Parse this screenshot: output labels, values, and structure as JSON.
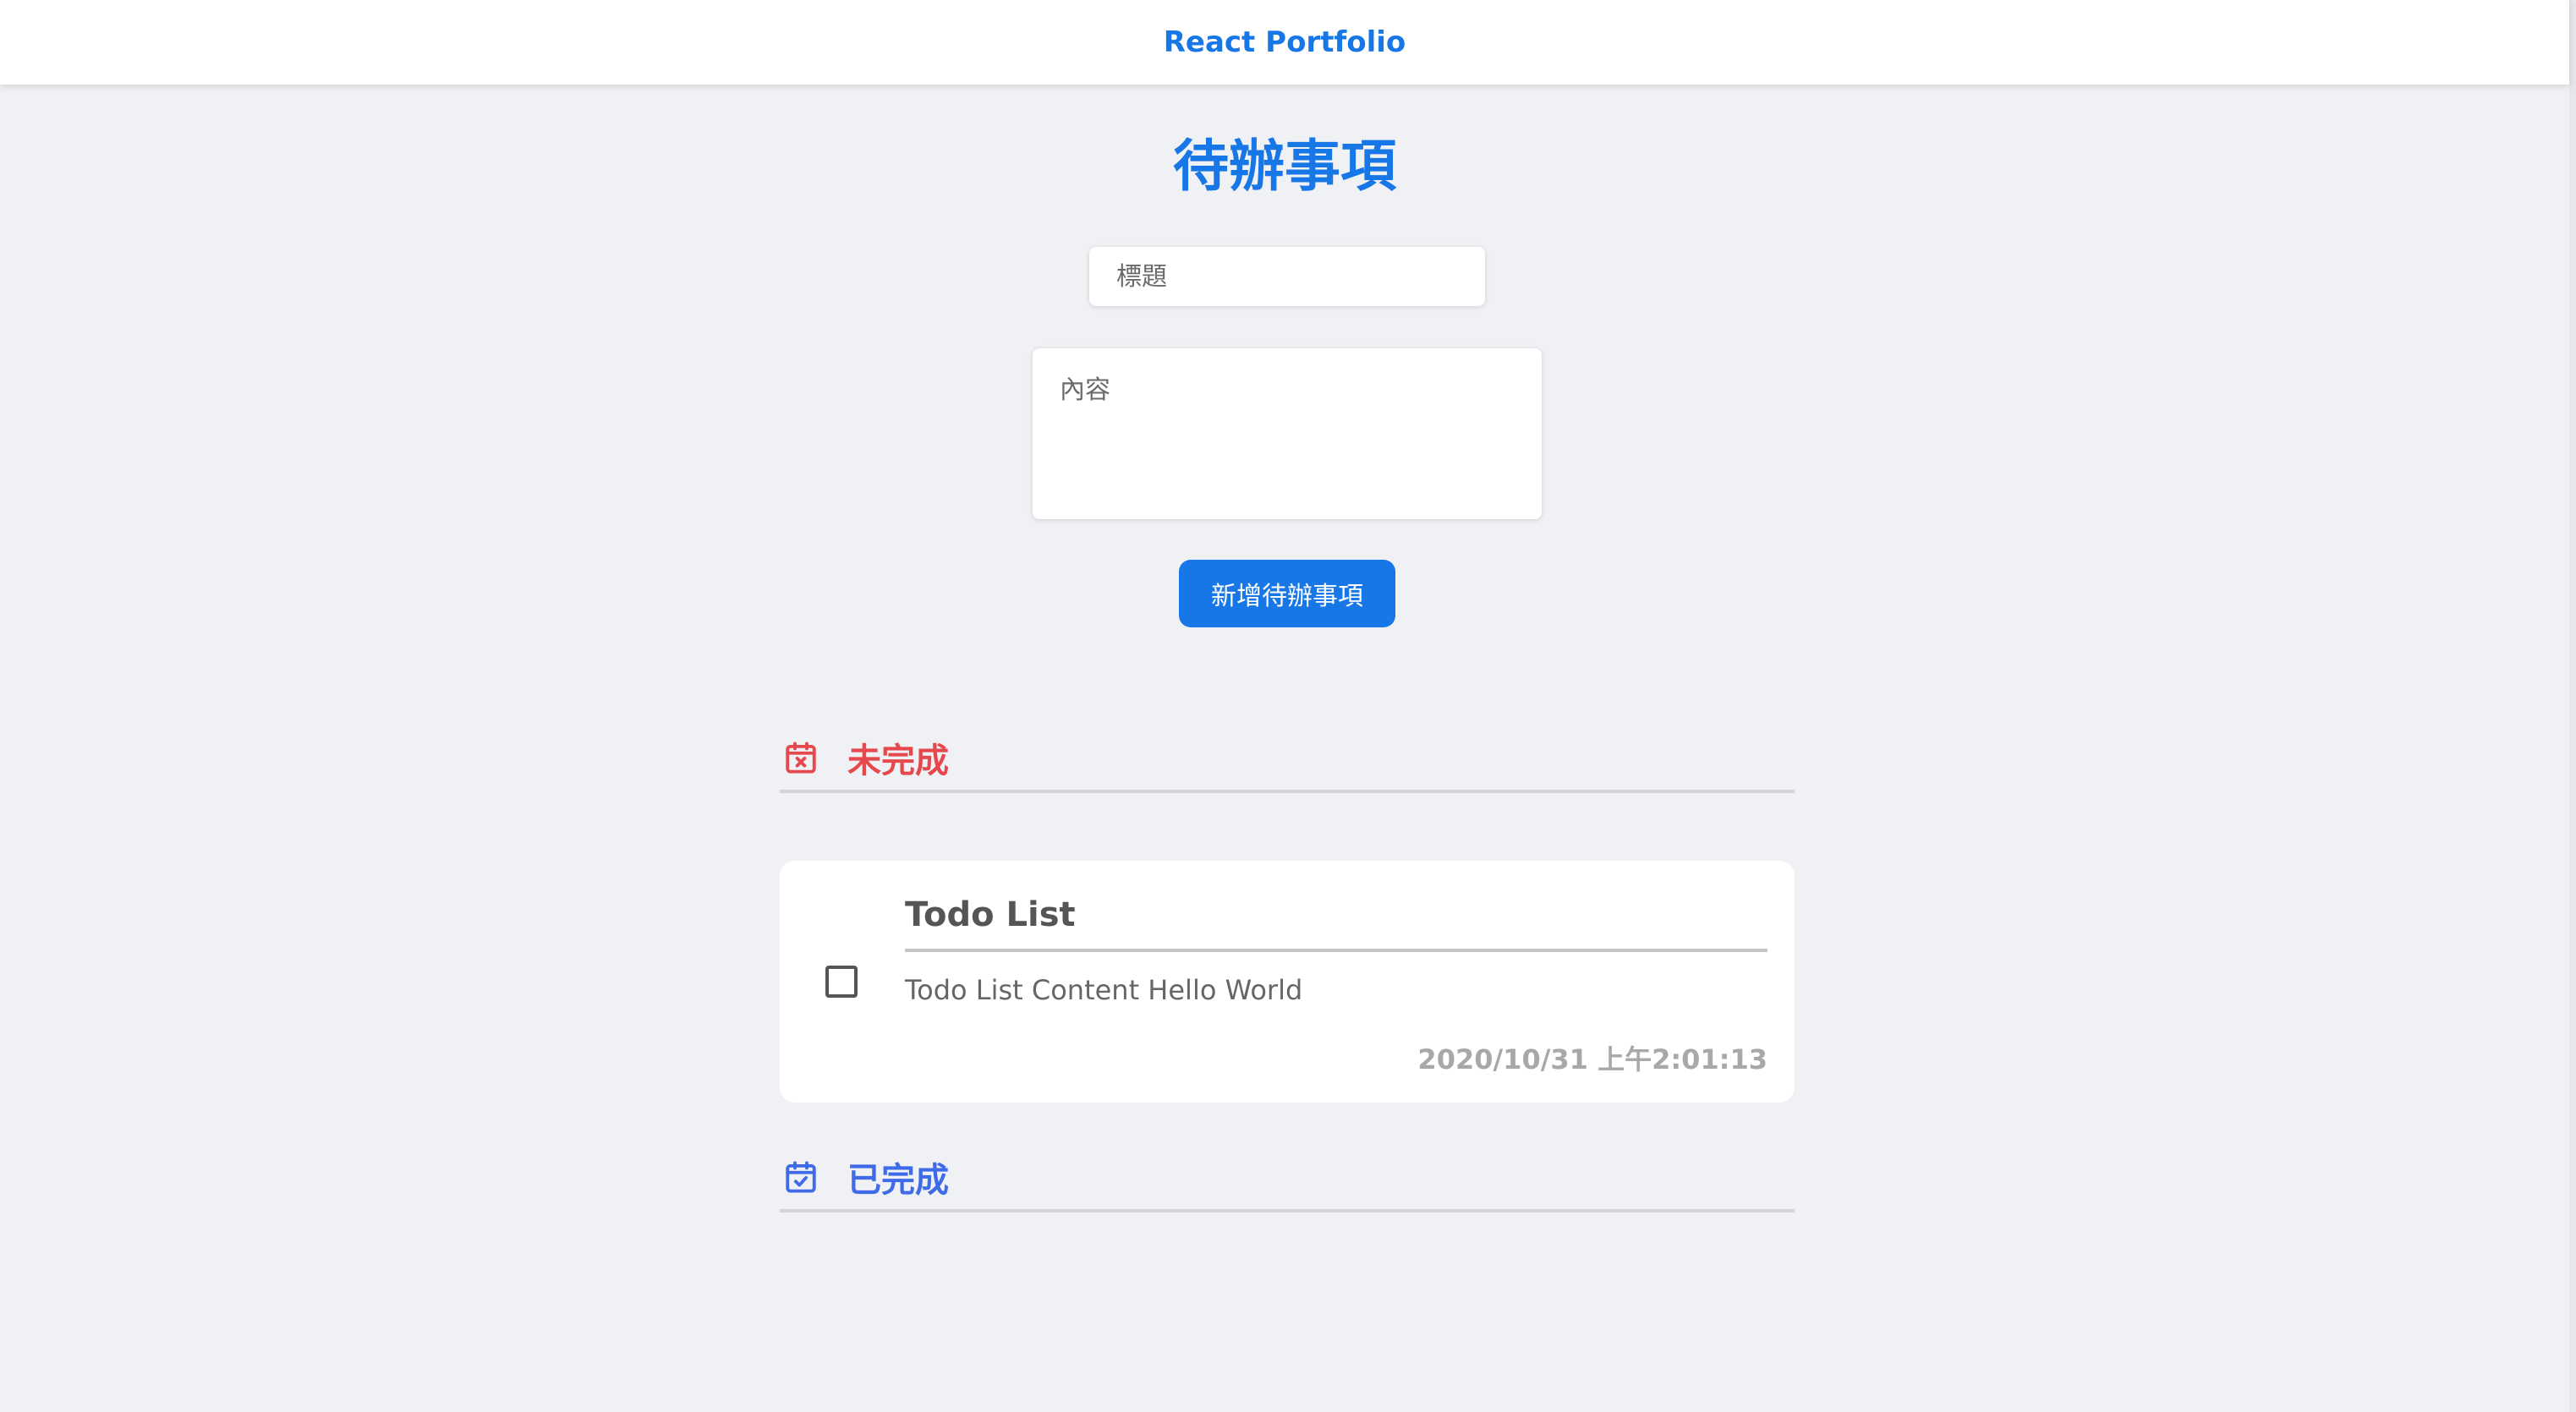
{
  "navbar": {
    "brand": "React Portfolio"
  },
  "page": {
    "title": "待辦事項"
  },
  "form": {
    "title_placeholder": "標題",
    "title_value": "",
    "content_placeholder": "內容",
    "content_value": "",
    "submit_label": "新增待辦事項"
  },
  "sections": {
    "incomplete": {
      "label": "未完成",
      "icon": "calendar-x-icon",
      "color": "#e5484d",
      "todos": [
        {
          "title": "Todo List",
          "content": "Todo List Content Hello World",
          "timestamp": "2020/10/31 上午2:01:13",
          "checked": false
        }
      ]
    },
    "complete": {
      "label": "已完成",
      "icon": "calendar-check-icon",
      "color": "#3f6be8",
      "todos": []
    }
  },
  "colors": {
    "accent": "#1877e6",
    "background": "#f0f1f5"
  }
}
